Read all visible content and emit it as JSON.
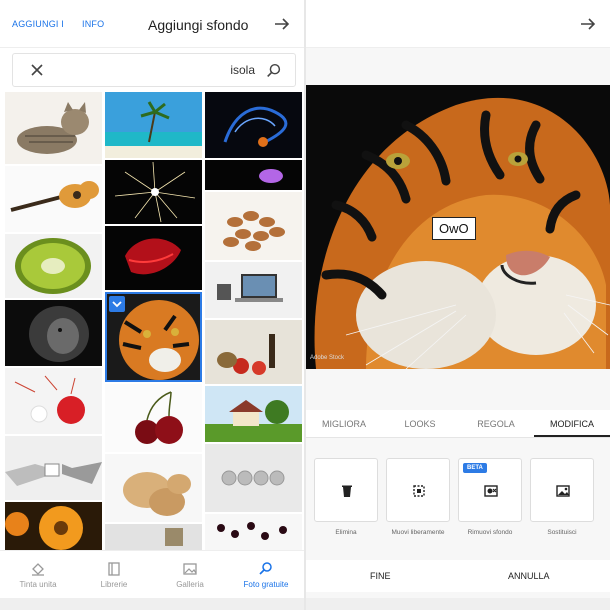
{
  "left_panel": {
    "header": {
      "link_add": "AGGIUNGI I",
      "link_info": "INFO",
      "title": "Aggiungi sfondo",
      "arrow_icon": "arrow-right-icon"
    },
    "search": {
      "value": "isola",
      "clear_icon": "close-icon",
      "search_icon": "search-icon"
    },
    "bottom_tabs": [
      {
        "label": "Tinta unita",
        "icon": "paint-bucket-icon"
      },
      {
        "label": "Librerie",
        "icon": "library-icon"
      },
      {
        "label": "Galleria",
        "icon": "gallery-icon"
      },
      {
        "label": "Foto gratuite",
        "icon": "search-icon"
      }
    ],
    "accent": "#1a73e8"
  },
  "right_panel": {
    "overlay_text": "OwO",
    "watermark": "Adobe Stock",
    "tabs": [
      "MIGLIORA",
      "LOOKS",
      "REGOLA",
      "MODIFICA"
    ],
    "actions": [
      {
        "label": "Elimina",
        "icon": "trash-icon"
      },
      {
        "label": "Muovi liberamente",
        "icon": "move-free-icon"
      },
      {
        "label": "Rimuovi sfondo",
        "icon": "remove-background-icon",
        "badge": "BETA"
      },
      {
        "label": "Sostituisci",
        "icon": "replace-icon"
      }
    ],
    "footer": {
      "done": "FINE",
      "cancel": "ANNULLA"
    }
  }
}
